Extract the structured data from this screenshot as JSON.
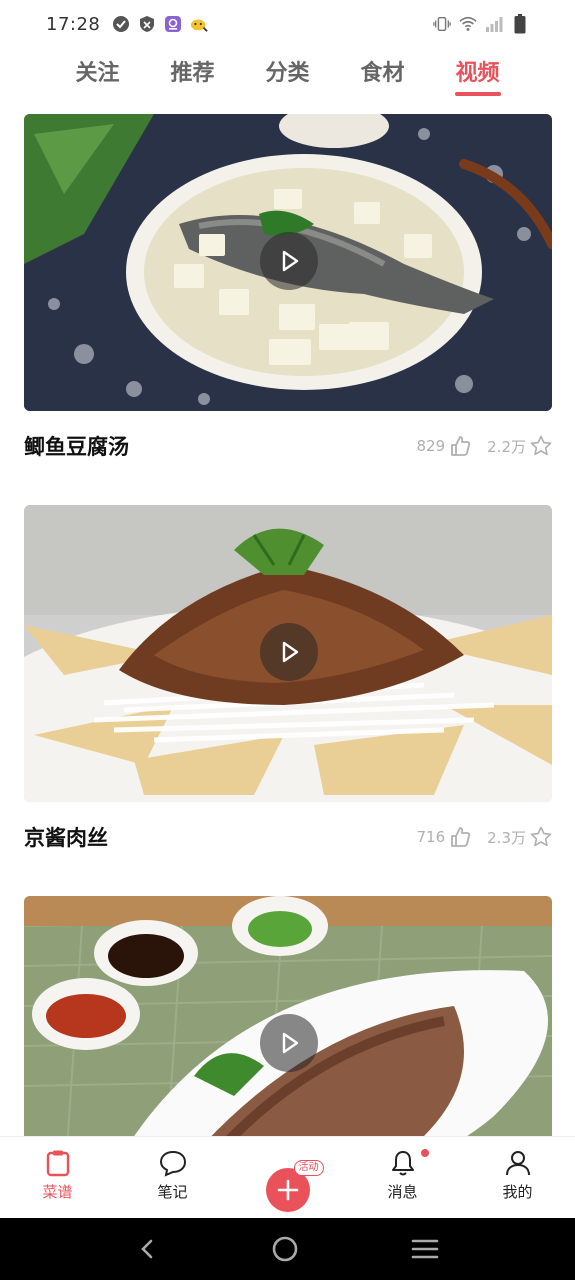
{
  "status_bar": {
    "time": "17:28"
  },
  "top_tabs": [
    {
      "label": "关注",
      "active": false
    },
    {
      "label": "推荐",
      "active": false
    },
    {
      "label": "分类",
      "active": false
    },
    {
      "label": "食材",
      "active": false
    },
    {
      "label": "视频",
      "active": true
    }
  ],
  "feed": [
    {
      "title": "鲫鱼豆腐汤",
      "likes": "829",
      "favorites": "2.2万",
      "thumbnail": "fish-tofu-soup"
    },
    {
      "title": "京酱肉丝",
      "likes": "716",
      "favorites": "2.3万",
      "thumbnail": "shredded-pork"
    },
    {
      "title": "",
      "likes": "",
      "favorites": "",
      "thumbnail": "sliced-braised-beef"
    }
  ],
  "bottom_nav": {
    "recipes": "菜谱",
    "notes": "笔记",
    "add_badge": "活动",
    "messages": "消息",
    "mine": "我的"
  },
  "colors": {
    "accent": "#e9525a"
  }
}
